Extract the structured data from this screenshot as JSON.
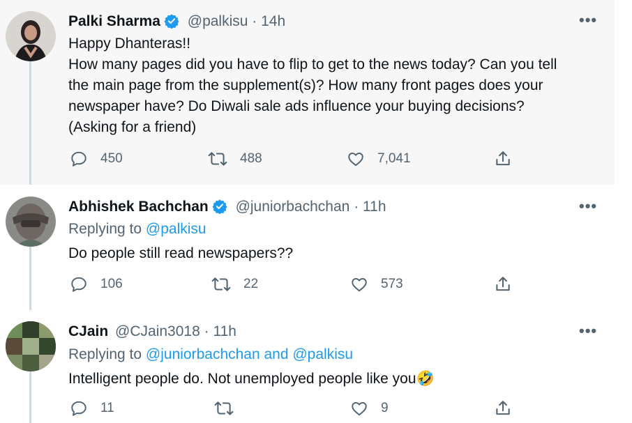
{
  "tweets": [
    {
      "name": "Palki Sharma",
      "handle": "@palkisu",
      "separator": "·",
      "time": "14h",
      "verified": true,
      "text_lines": [
        "Happy Dhanteras!!",
        "How many pages did you have to flip to get to the news today? Can you tell",
        "the main page from the supplement(s)? How many front pages does your",
        "newspaper have?  Do Diwali sale ads influence your buying decisions?",
        "(Asking for a friend)"
      ],
      "replies": "450",
      "retweets": "488",
      "likes": "7,041"
    },
    {
      "name": "Abhishek Bachchan",
      "handle": "@juniorbachchan",
      "separator": "·",
      "time": "11h",
      "verified": true,
      "replying_prefix": "Replying to ",
      "replying_link": "@palkisu",
      "text": "Do people still read newspapers??",
      "replies": "106",
      "retweets": "22",
      "likes": "573"
    },
    {
      "name": "CJain",
      "handle": "@CJain3018",
      "separator": "·",
      "time": "11h",
      "verified": false,
      "replying_prefix": "Replying to ",
      "replying_link": "@juniorbachchan and @palkisu",
      "text": "Intelligent people do. Not unemployed people like you",
      "emoji": "🤣",
      "replies": "11",
      "retweets": "",
      "likes": "9"
    }
  ],
  "more_glyph": "•••",
  "colors": {
    "accent": "#1d9bf0",
    "muted": "#536471",
    "text": "#0f1419",
    "highlight_bg": "#f7f7f7"
  },
  "icons": [
    "reply-icon",
    "retweet-icon",
    "like-icon",
    "share-icon",
    "verified-badge-icon",
    "more-options-icon"
  ]
}
